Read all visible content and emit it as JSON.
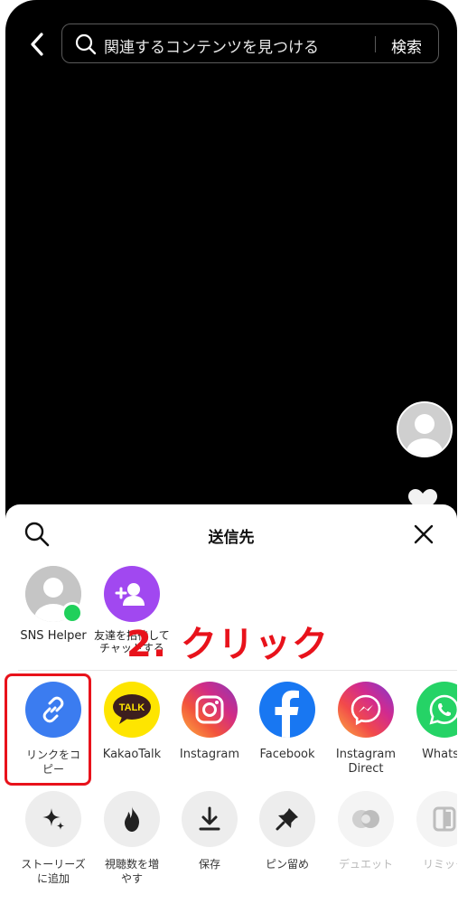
{
  "header": {
    "search_placeholder": "関連するコンテンツを見つける",
    "search_button": "検索"
  },
  "sheet": {
    "title": "送信先",
    "contacts": [
      {
        "name": "SNS Helper",
        "online": true
      },
      {
        "name": "友達を招待して\nチャットする"
      }
    ],
    "share_row": [
      {
        "label": "リンクをコ\nピー",
        "icon": "link-icon"
      },
      {
        "label": "KakaoTalk",
        "icon": "kakaotalk-icon"
      },
      {
        "label": "Instagram",
        "icon": "instagram-icon"
      },
      {
        "label": "Facebook",
        "icon": "facebook-icon"
      },
      {
        "label": "Instagram\nDirect",
        "icon": "messenger-icon"
      },
      {
        "label": "WhatsA",
        "icon": "whatsapp-icon"
      }
    ],
    "action_row": [
      {
        "label": "ストーリーズ\nに追加",
        "icon": "sparkle-icon"
      },
      {
        "label": "視聴数を増\nやす",
        "icon": "flame-icon"
      },
      {
        "label": "保存",
        "icon": "download-icon"
      },
      {
        "label": "ピン留め",
        "icon": "pin-icon"
      },
      {
        "label": "デュエット",
        "icon": "duet-icon",
        "disabled": true
      },
      {
        "label": "リミック",
        "icon": "remix-icon",
        "disabled": true
      }
    ]
  },
  "annotation": {
    "text": "2. クリック",
    "color": "#e8121b"
  },
  "colors": {
    "link": "#3b7cf0",
    "kakao": "#fee500",
    "facebook": "#1877f2",
    "whatsapp": "#25d366",
    "invite": "#a148f0"
  }
}
